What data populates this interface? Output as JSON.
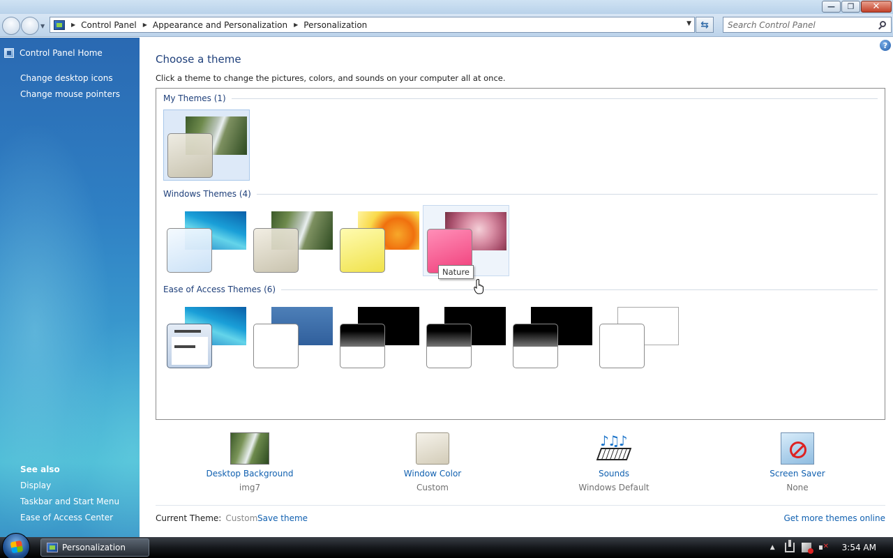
{
  "window": {
    "minimize_glyph": "—",
    "maximize_glyph": "❐",
    "close_glyph": "✕"
  },
  "address": {
    "crumbs": [
      "Control Panel",
      "Appearance and Personalization",
      "Personalization"
    ],
    "search_placeholder": "Search Control Panel"
  },
  "sidebar": {
    "home": "Control Panel Home",
    "tasks": [
      "Change desktop icons",
      "Change mouse pointers"
    ],
    "see_also_title": "See also",
    "see_also": [
      "Display",
      "Taskbar and Start Menu",
      "Ease of Access Center"
    ]
  },
  "main": {
    "help_glyph": "?",
    "title": "Choose a theme",
    "description": "Click a theme to change the pictures, colors, and sounds on your computer all at once.",
    "groups": {
      "my_themes": "My Themes (1)",
      "windows_themes": "Windows Themes (4)",
      "ease_themes": "Ease of Access Themes (6)"
    },
    "tooltip": "Nature"
  },
  "settings": [
    {
      "label": "Desktop Background",
      "value": "img7",
      "icon": "desktop-background-icon"
    },
    {
      "label": "Window Color",
      "value": "Custom",
      "icon": "window-color-icon"
    },
    {
      "label": "Sounds",
      "value": "Windows Default",
      "icon": "sounds-icon"
    },
    {
      "label": "Screen Saver",
      "value": "None",
      "icon": "screen-saver-icon"
    }
  ],
  "footer": {
    "current_theme_label": "Current Theme:",
    "current_theme_value": "Custom",
    "save_theme": "Save theme",
    "more_themes": "Get more themes online"
  },
  "taskbar": {
    "task_label": "Personalization",
    "clock": "3:54 AM"
  },
  "colors": {
    "accent_link": "#1060b0",
    "heading": "#1e3f7a",
    "selected_theme": "#dde9f8"
  }
}
